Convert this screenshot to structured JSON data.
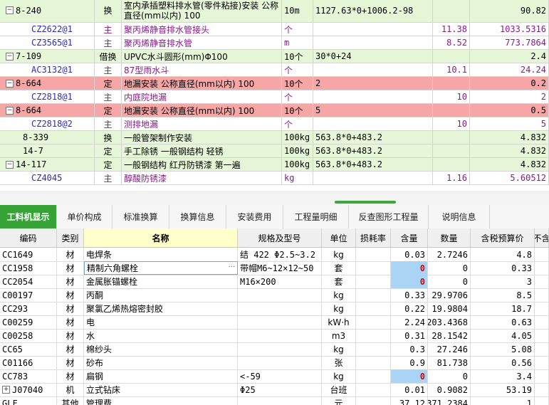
{
  "top_rows": [
    {
      "code": "8-240",
      "tree": "minus",
      "type": "换",
      "name": "室内承插塑料排水管(零件粘接)安装 公称直径(mm以内) 100",
      "unit": "10m",
      "formula": "1127.63*0+1006.2-98",
      "qty": "",
      "price": "90.82",
      "style": "main",
      "indent": 1
    },
    {
      "code": "CZ2622@1",
      "type": "主",
      "name": "聚丙烯静音排水管接头",
      "unit": "个",
      "formula": "",
      "qty": "11.38",
      "price": "1033.5316",
      "style": "sub"
    },
    {
      "code": "CZ3565@1",
      "type": "主",
      "name": "聚丙烯静音排水管",
      "unit": "m",
      "formula": "",
      "qty": "8.52",
      "price": "773.7864",
      "style": "sub"
    },
    {
      "code": "7-109",
      "tree": "minus",
      "type": "借换",
      "name": "UPVC水斗圆形(mm)Φ100",
      "unit": "10个",
      "formula": "30*0+24",
      "qty": "",
      "price": "2.4",
      "style": "main",
      "indent": 1
    },
    {
      "code": "AC3132@1",
      "type": "主",
      "name": "87型雨水斗",
      "unit": "个",
      "formula": "",
      "qty": "10.1",
      "price": "24.24",
      "style": "sub"
    },
    {
      "code": "8-664",
      "tree": "minus",
      "type": "定",
      "name": "地漏安装 公称直径(mm以内) 100",
      "unit": "10个",
      "formula": "2",
      "qty": "",
      "price": "0.2",
      "style": "red",
      "indent": 1
    },
    {
      "code": "CZ2818@1",
      "type": "主",
      "name": "内庭院地漏",
      "unit": "个",
      "formula": "",
      "qty": "10",
      "price": "2",
      "style": "sub"
    },
    {
      "code": "8-664",
      "tree": "minus",
      "type": "定",
      "name": "地漏安装 公称直径(mm以内) 100",
      "unit": "10个",
      "formula": "5",
      "qty": "",
      "price": "0.5",
      "style": "red",
      "indent": 1
    },
    {
      "code": "CZ2818@2",
      "type": "主",
      "name": "测排地漏",
      "unit": "个",
      "formula": "",
      "qty": "10",
      "price": "5",
      "style": "sub"
    },
    {
      "code": "8-339",
      "type": "换",
      "name": "一般管架制作安装",
      "unit": "100kg",
      "formula": "563.8*0+483.2",
      "qty": "",
      "price": "4.832",
      "style": "main",
      "indent": 2
    },
    {
      "code": "14-7",
      "type": "定",
      "name": "手工除锈 一般钢结构 轻锈",
      "unit": "100kg",
      "formula": "563.8*0+483.2",
      "qty": "",
      "price": "4.832",
      "style": "main",
      "indent": 2
    },
    {
      "code": "14-117",
      "tree": "minus",
      "type": "定",
      "name": "一般钢结构 红丹防锈漆 第一遍",
      "unit": "100kg",
      "formula": "563.8*0+483.2",
      "qty": "",
      "price": "4.832",
      "style": "main",
      "indent": 1
    },
    {
      "code": "CZ4045",
      "type": "主",
      "name": "醇酸防锈漆",
      "unit": "kg",
      "formula": "",
      "qty": "1.16",
      "price": "5.60512",
      "style": "sub"
    }
  ],
  "tabs": [
    {
      "label": "工料机显示",
      "active": true
    },
    {
      "label": "单价构成"
    },
    {
      "label": "标准换算"
    },
    {
      "label": "换算信息"
    },
    {
      "label": "安装费用"
    },
    {
      "label": "工程量明细"
    },
    {
      "label": "反查图形工程量"
    },
    {
      "label": "说明信息"
    }
  ],
  "bottom_headers": [
    "编码",
    "类别",
    "名称",
    "规格及型号",
    "单位",
    "损耗率",
    "含量",
    "数量",
    "含税预算价",
    "不含"
  ],
  "bottom_rows": [
    {
      "code": "CC1649",
      "cat": "材",
      "name": "电焊条",
      "spec": "结 422 Φ2.5~3.2",
      "unit": "kg",
      "loss": "",
      "content": "0.03",
      "qty": "2.7246",
      "price": "4.8",
      "hl": false
    },
    {
      "code": "CC1958",
      "cat": "材",
      "name": "精制六角螺栓",
      "spec": "带帽M6~12×12~50",
      "unit": "套",
      "loss": "",
      "content": "0",
      "qty": "0",
      "price": "0.33",
      "hl": true,
      "editing": true
    },
    {
      "code": "CC2054",
      "cat": "材",
      "name": "金属胀锚螺栓",
      "spec": "M16×200",
      "unit": "套",
      "loss": "",
      "content": "0",
      "qty": "0",
      "price": "3",
      "hl": true
    },
    {
      "code": "C00197",
      "cat": "材",
      "name": "丙酮",
      "spec": "",
      "unit": "kg",
      "loss": "",
      "content": "0.33",
      "qty": "29.9706",
      "price": "8.5",
      "hl": false
    },
    {
      "code": "CC293",
      "cat": "材",
      "name": "聚氯乙烯热熔密封胶",
      "spec": "",
      "unit": "kg",
      "loss": "",
      "content": "0.22",
      "qty": "19.9804",
      "price": "18.7",
      "hl": false
    },
    {
      "code": "C00259",
      "cat": "材",
      "name": "电",
      "spec": "",
      "unit": "kW·h",
      "loss": "",
      "content": "2.24",
      "qty": "203.4368",
      "price": "0.63",
      "hl": false
    },
    {
      "code": "C00258",
      "cat": "材",
      "name": "水",
      "spec": "",
      "unit": "m3",
      "loss": "",
      "content": "0.31",
      "qty": "28.1542",
      "price": "4.05",
      "hl": false
    },
    {
      "code": "CC65",
      "cat": "材",
      "name": "棉纱头",
      "spec": "",
      "unit": "kg",
      "loss": "",
      "content": "0.3",
      "qty": "27.246",
      "price": "5.08",
      "hl": false
    },
    {
      "code": "C01166",
      "cat": "材",
      "name": "砂布",
      "spec": "",
      "unit": "张",
      "loss": "",
      "content": "0.9",
      "qty": "81.738",
      "price": "0.56",
      "hl": false
    },
    {
      "code": "CC783",
      "cat": "材",
      "name": "扁钢",
      "spec": "<-59",
      "unit": "kg",
      "loss": "",
      "content": "0",
      "qty": "0",
      "price": "3.4",
      "hl": true
    },
    {
      "code": "J07040",
      "cat": "机",
      "name": "立式钻床",
      "spec": "Φ25",
      "unit": "台班",
      "loss": "",
      "content": "0.01",
      "qty": "0.9082",
      "price": "53.19",
      "hl": false,
      "tree": "plus"
    },
    {
      "code": "GLF",
      "cat": "其他",
      "name": "管理费",
      "spec": "",
      "unit": "元",
      "loss": "",
      "content": "37.12",
      "qty": "3371.2384",
      "price": "1",
      "hl": false
    }
  ],
  "colors": {
    "active_tab": "#35a335",
    "main_row": "#e6f7d8",
    "red_row": "#f7a6a6",
    "highlight_cell": "#a9d4f5",
    "sub_text": "#8a1a8a"
  }
}
